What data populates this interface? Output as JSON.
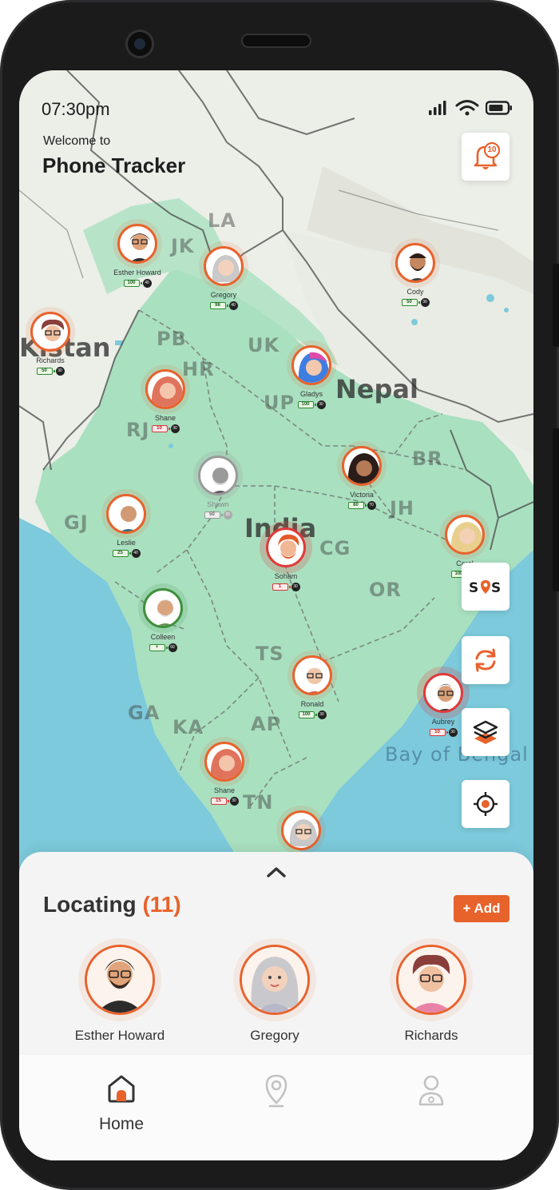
{
  "status_bar": {
    "time": "07:30pm"
  },
  "header": {
    "welcome": "Welcome to",
    "title": "Phone Tracker"
  },
  "notifications": {
    "count": "10"
  },
  "tools": {
    "sos_label": "SOS"
  },
  "map": {
    "regions": [
      "LA",
      "JK",
      "PB",
      "HR",
      "UK",
      "UP",
      "Nepal",
      "RJ",
      "BR",
      "GJ",
      "India",
      "CG",
      "JH",
      "OR",
      "TS",
      "GA",
      "KA",
      "AP",
      "TN",
      "Bay of Bengal",
      "Kistan"
    ],
    "markers": [
      {
        "name": "Esther Howard",
        "battery": "100",
        "speed": "40",
        "style": "orange"
      },
      {
        "name": "Gregory",
        "battery": "98",
        "speed": "40",
        "style": "orange"
      },
      {
        "name": "Cody",
        "battery": "50",
        "speed": "30",
        "style": "orange"
      },
      {
        "name": "Richards",
        "battery": "50",
        "speed": "30",
        "style": "orange"
      },
      {
        "name": "Gladys",
        "battery": "100",
        "speed": "30",
        "style": "orange"
      },
      {
        "name": "Shane",
        "battery": "10",
        "speed": "30",
        "style": "orange"
      },
      {
        "name": "Shawn",
        "battery": "50",
        "speed": "30",
        "style": "grey"
      },
      {
        "name": "Victoria",
        "battery": "80",
        "speed": "70",
        "style": "orange"
      },
      {
        "name": "Leslie",
        "battery": "25",
        "speed": "40",
        "style": "orange"
      },
      {
        "name": "Soham",
        "battery": "1",
        "speed": "30",
        "style": "red"
      },
      {
        "name": "Carol",
        "battery": "100",
        "speed": "30",
        "style": "orange"
      },
      {
        "name": "Colleen",
        "battery": "+",
        "speed": "60",
        "style": "green"
      },
      {
        "name": "Ronald",
        "battery": "100",
        "speed": "30",
        "style": "orange"
      },
      {
        "name": "Aubrey",
        "battery": "10",
        "speed": "30",
        "style": "red"
      },
      {
        "name": "Shane",
        "battery": "15",
        "speed": "30",
        "style": "orange"
      }
    ]
  },
  "sheet": {
    "title": "Locating",
    "count": "(11)",
    "add_label": "+ Add",
    "people": [
      "Esther Howard",
      "Gregory",
      "Richards"
    ]
  },
  "nav": {
    "home_label": "Home"
  },
  "colors": {
    "accent": "#e8622c",
    "land": "#a6dfc1",
    "sea": "#76c9dd"
  }
}
